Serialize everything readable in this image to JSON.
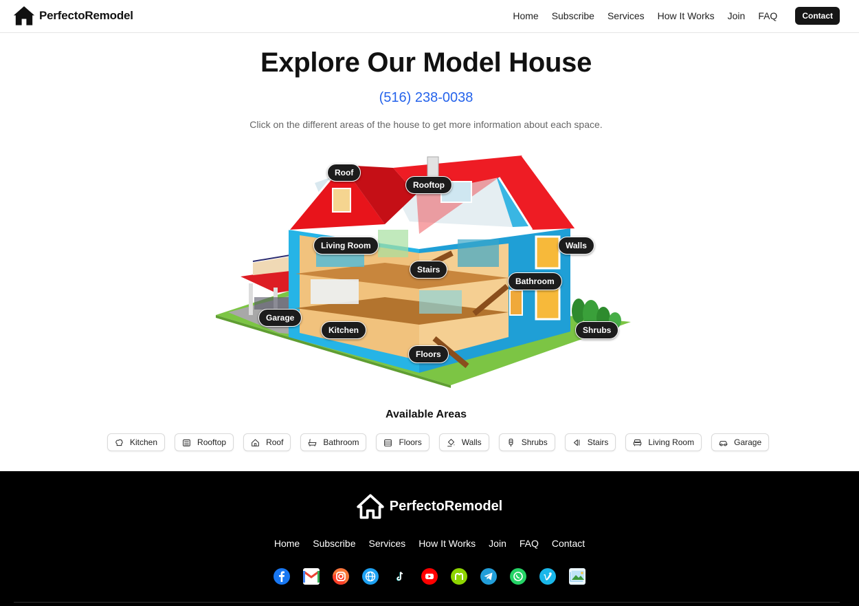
{
  "header": {
    "brand": "PerfectoRemodel",
    "nav": [
      "Home",
      "Subscribe",
      "Services",
      "How It Works",
      "Join",
      "FAQ"
    ],
    "contact_label": "Contact"
  },
  "hero": {
    "title": "Explore Our Model House",
    "phone": "(516) 238-0038",
    "subtitle": "Click on the different areas of the house to get more information about each space."
  },
  "house": {
    "hotspots": [
      "Roof",
      "Rooftop",
      "Living Room",
      "Walls",
      "Stairs",
      "Bathroom",
      "Garage",
      "Kitchen",
      "Shrubs",
      "Floors"
    ]
  },
  "areas": {
    "title": "Available Areas",
    "items": [
      {
        "label": "Kitchen",
        "icon": "chef-hat-icon"
      },
      {
        "label": "Rooftop",
        "icon": "rooftop-panel-icon"
      },
      {
        "label": "Roof",
        "icon": "house-icon"
      },
      {
        "label": "Bathroom",
        "icon": "bathtub-icon"
      },
      {
        "label": "Floors",
        "icon": "floor-layers-icon"
      },
      {
        "label": "Walls",
        "icon": "paint-bucket-icon"
      },
      {
        "label": "Shrubs",
        "icon": "tree-icon"
      },
      {
        "label": "Stairs",
        "icon": "stairs-icon"
      },
      {
        "label": "Living Room",
        "icon": "sofa-icon"
      },
      {
        "label": "Garage",
        "icon": "car-icon"
      }
    ]
  },
  "footer": {
    "brand": "PerfectoRemodel",
    "nav": [
      "Home",
      "Subscribe",
      "Services",
      "How It Works",
      "Join",
      "FAQ",
      "Contact"
    ],
    "socials": [
      {
        "name": "facebook-icon",
        "color": "#1877f2"
      },
      {
        "name": "gmail-icon",
        "color": "#ea4335"
      },
      {
        "name": "instagram-icon",
        "color": "#e1306c"
      },
      {
        "name": "website-globe-icon",
        "color": "#1da1f2"
      },
      {
        "name": "tiktok-icon",
        "color": "#000000"
      },
      {
        "name": "youtube-icon",
        "color": "#ff0000"
      },
      {
        "name": "nextdoor-icon",
        "color": "#8ed500"
      },
      {
        "name": "telegram-icon",
        "color": "#229ed9"
      },
      {
        "name": "whatsapp-icon",
        "color": "#25d366"
      },
      {
        "name": "vimeo-icon",
        "color": "#1ab7ea"
      },
      {
        "name": "photos-icon",
        "color": "#5bb0e8"
      }
    ]
  },
  "colors": {
    "accent_blue": "#2563eb",
    "roof_red": "#e8141b",
    "wall_cyan": "#2bb5e3",
    "footer_bg": "#000000"
  }
}
